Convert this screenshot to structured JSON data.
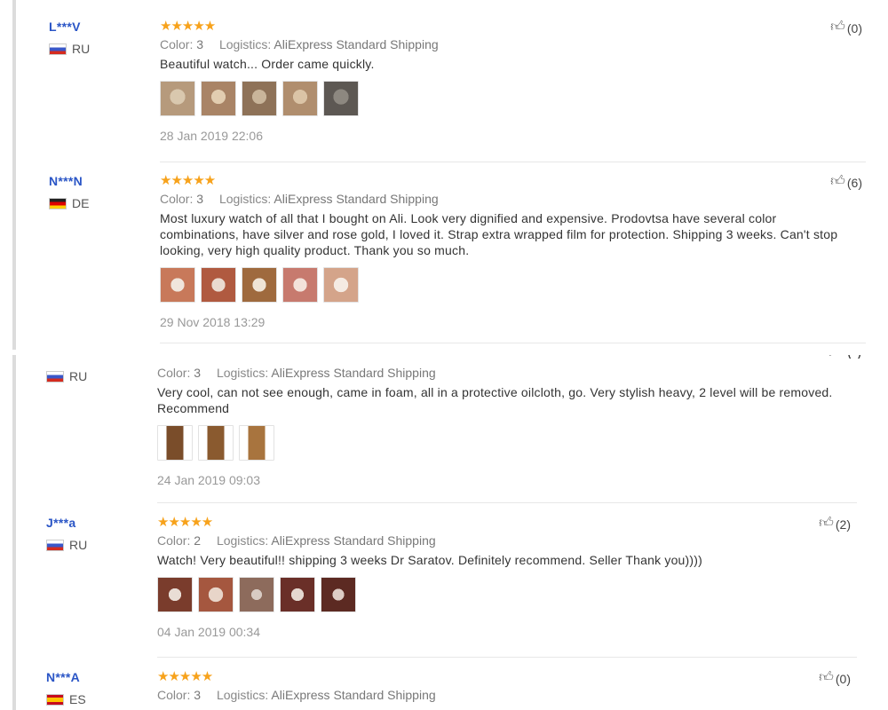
{
  "reviews": [
    {
      "user": "L***V",
      "country": "RU",
      "stars": "★★★★★",
      "color_label": "Color:",
      "color_value": "3",
      "logistics_label": "Logistics:",
      "logistics_value": "AliExpress Standard Shipping",
      "text": "Beautiful watch... Order came quickly.",
      "date": "28 Jan 2019 22:06",
      "likes": "(0)",
      "thumbs": [
        "#b69a7c",
        "#a98466",
        "#8e7258",
        "#b08e6e",
        "#5d5853"
      ]
    },
    {
      "user": "N***N",
      "country": "DE",
      "stars": "★★★★★",
      "color_label": "Color:",
      "color_value": "3",
      "logistics_label": "Logistics:",
      "logistics_value": "AliExpress Standard Shipping",
      "text": "Most luxury watch of all that I bought on Ali. Look very dignified and expensive. Prodovtsa have several color combinations, have silver and rose gold, I loved it. Strap extra wrapped film for protection. Shipping 3 weeks. Can't stop looking, very high quality product. Thank you so much.",
      "date": "29 Nov 2018 13:29",
      "likes": "(6)",
      "thumbs": [
        "#c8795a",
        "#b05a40",
        "#9f6a3e",
        "#c77a6e",
        "#d4a48a"
      ]
    },
    {
      "user": "",
      "country": "RU",
      "stars": "",
      "color_label": "Color:",
      "color_value": "3",
      "logistics_label": "Logistics:",
      "logistics_value": "AliExpress Standard Shipping",
      "text": "Very cool, can not see enough, came in foam, all in a protective oilcloth, go. Very stylish heavy, 2 level will be removed. Recommend",
      "date": "24 Jan 2019 09:03",
      "likes": "",
      "thumbs": [
        "#7a4d2a",
        "#8a5a2f",
        "#a8743e"
      ]
    },
    {
      "user": "J***a",
      "country": "RU",
      "stars": "★★★★★",
      "color_label": "Color:",
      "color_value": "2",
      "logistics_label": "Logistics:",
      "logistics_value": "AliExpress Standard Shipping",
      "text": "Watch! Very beautiful!! shipping 3 weeks Dr Saratov. Definitely recommend. Seller Thank you))))",
      "date": "04 Jan 2019 00:34",
      "likes": "(2)",
      "thumbs": [
        "#7a3c2c",
        "#a5573f",
        "#8d6b5c",
        "#6a2f28",
        "#5c2a22"
      ]
    },
    {
      "user": "N***A",
      "country": "ES",
      "stars": "★★★★★",
      "color_label": "Color:",
      "color_value": "3",
      "logistics_label": "Logistics:",
      "logistics_value": "AliExpress Standard Shipping",
      "text": "",
      "date": "",
      "likes": "(0)",
      "thumbs": []
    }
  ],
  "colors": {
    "username": "#2a55c6",
    "stars": "#f7a21b",
    "text": "#333333",
    "muted": "#999999"
  },
  "icons": {
    "like": "thumbs-up-icon",
    "star": "star-icon",
    "flag": "country-flag-icon"
  }
}
